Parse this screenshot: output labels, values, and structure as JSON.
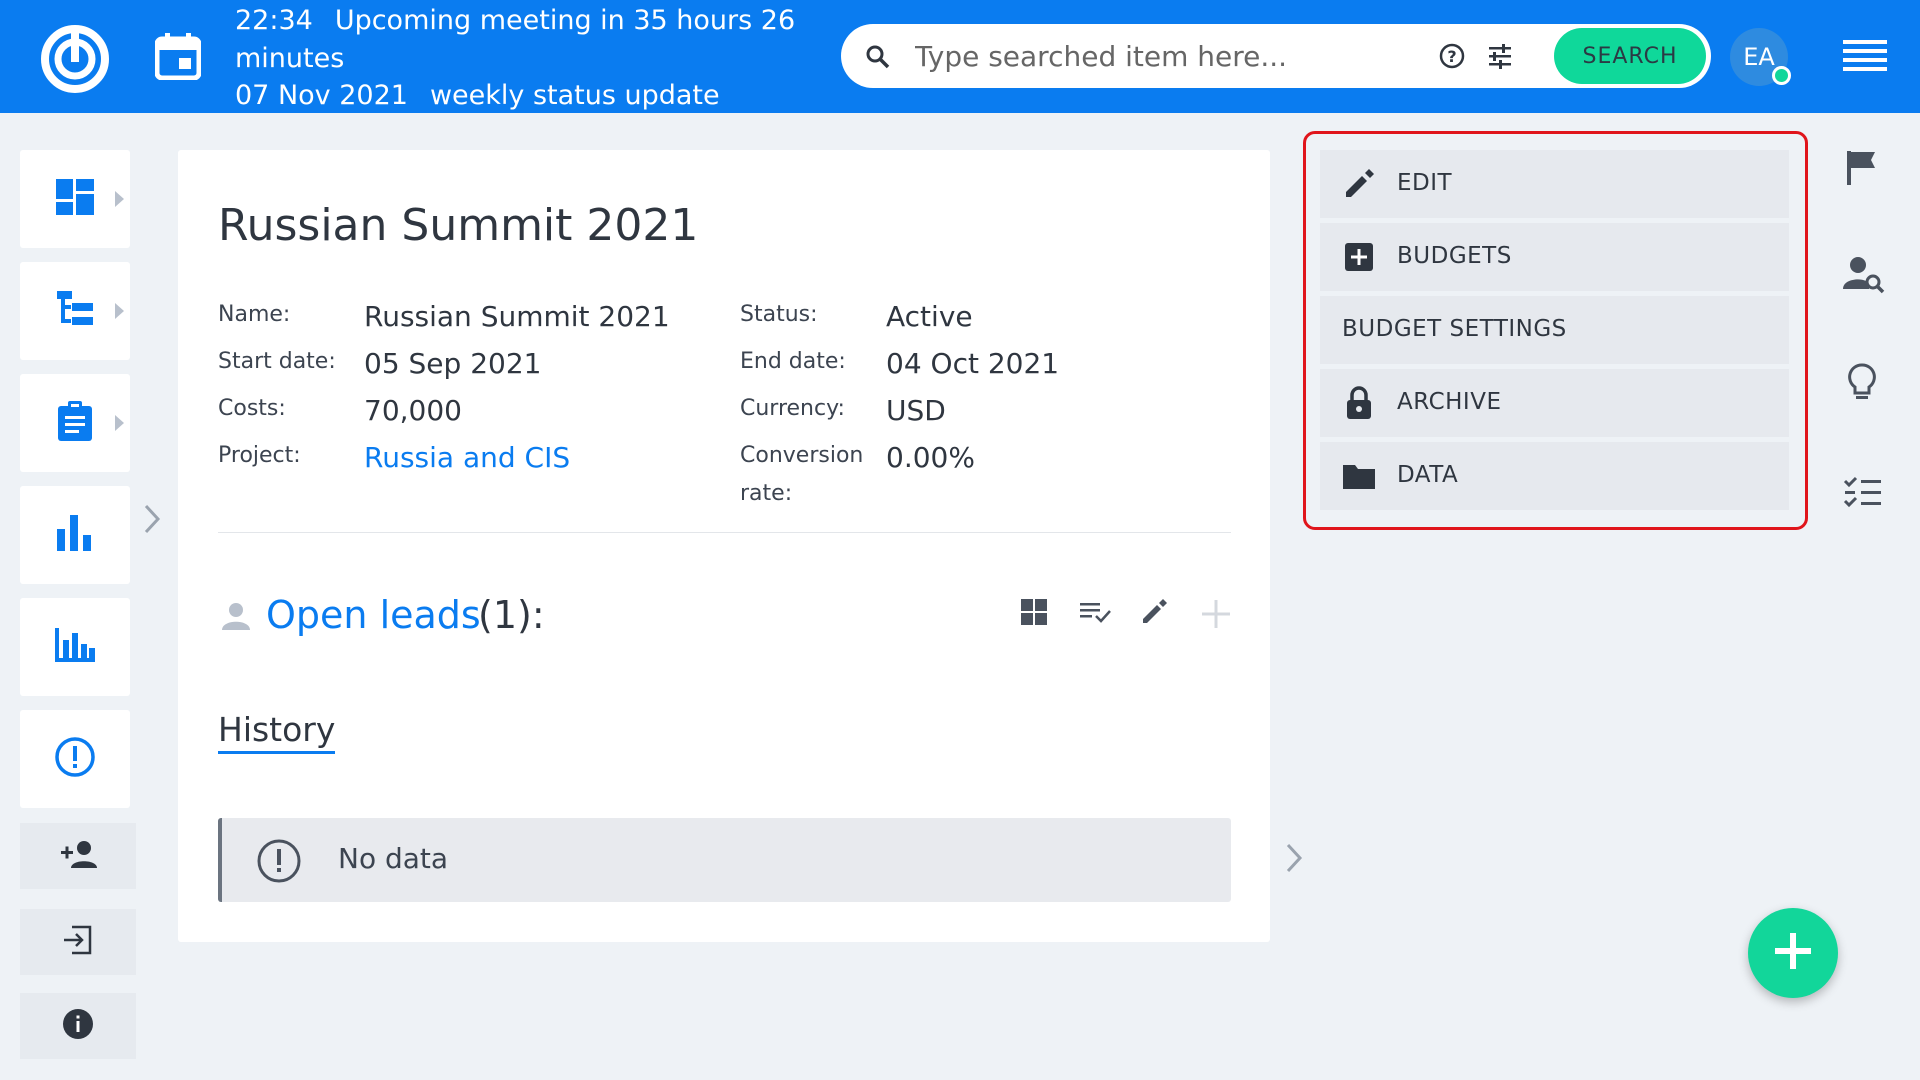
{
  "header": {
    "meeting_time": "22:34",
    "meeting_text": "Upcoming meeting in 35 hours 26",
    "meeting_text_cont": "minutes",
    "meeting_date": "07 Nov 2021",
    "meeting_title": "weekly status update",
    "search_placeholder": "Type searched item here...",
    "search_button": "SEARCH",
    "avatar_initials": "EA",
    "brand_color": "#0a7cf0",
    "status_color": "#12d69a"
  },
  "sidebar": {
    "items": [
      {
        "icon": "dashboard-icon",
        "has_submenu": true
      },
      {
        "icon": "tree-icon",
        "has_submenu": true
      },
      {
        "icon": "clipboard-icon",
        "has_submenu": true
      },
      {
        "icon": "bar-chart-icon",
        "has_submenu": false
      },
      {
        "icon": "analytics-icon",
        "has_submenu": false
      },
      {
        "icon": "alert-icon",
        "has_submenu": false
      }
    ],
    "bottom": [
      {
        "icon": "add-person-icon"
      },
      {
        "icon": "exit-icon"
      },
      {
        "icon": "info-icon"
      }
    ]
  },
  "entity": {
    "title": "Russian Summit 2021",
    "fields_left": [
      {
        "label": "Name:",
        "value": "Russian Summit 2021"
      },
      {
        "label": "Start date:",
        "value": "05 Sep 2021"
      },
      {
        "label": "Costs:",
        "value": "70,000"
      },
      {
        "label": "Project:",
        "value": "Russia and CIS"
      }
    ],
    "fields_right": [
      {
        "label": "Status:",
        "value": "Active"
      },
      {
        "label": "End date:",
        "value": "04 Oct 2021"
      },
      {
        "label": "Currency:",
        "value": "USD"
      },
      {
        "label": "Conversion",
        "label_cont": "rate:",
        "value": "0.00%"
      }
    ],
    "leads_title": "Open leads",
    "leads_count": "(1):",
    "history_tab": "History",
    "no_data": "No data"
  },
  "actions": [
    {
      "label": "EDIT",
      "icon": "pencil-icon"
    },
    {
      "label": "BUDGETS",
      "icon": "plus-square-icon"
    },
    {
      "label": "BUDGET SETTINGS",
      "icon": ""
    },
    {
      "label": "ARCHIVE",
      "icon": "lock-icon"
    },
    {
      "label": "DATA",
      "icon": "folder-icon"
    }
  ],
  "rail": [
    "flag-icon",
    "user-search-icon",
    "lightbulb-icon",
    "checklist-icon"
  ]
}
